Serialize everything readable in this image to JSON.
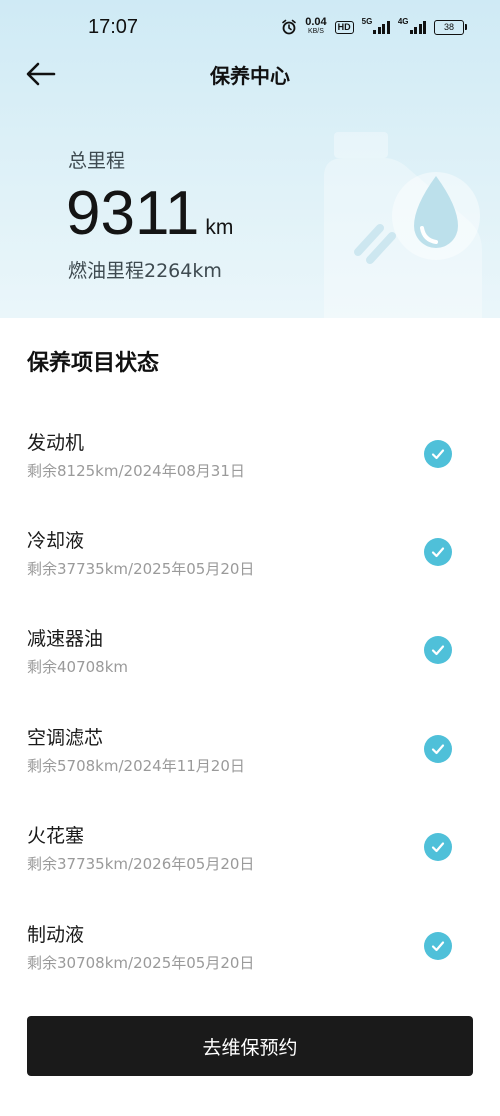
{
  "status_bar": {
    "time": "17:07",
    "net_speed_value": "0.04",
    "net_speed_unit": "KB/S",
    "hd_label": "HD",
    "sim1_label": "5G",
    "sim2_label": "4G",
    "battery": "38"
  },
  "header": {
    "title": "保养中心"
  },
  "mileage": {
    "total_label": "总里程",
    "total_value": "9311",
    "total_unit": "km",
    "fuel_mileage": "燃油里程2264km"
  },
  "section_title": "保养项目状态",
  "items": [
    {
      "name": "发动机",
      "detail": "剩余8125km/2024年08月31日",
      "status_icon": "check-icon"
    },
    {
      "name": "冷却液",
      "detail": "剩余37735km/2025年05月20日",
      "status_icon": "check-icon"
    },
    {
      "name": "减速器油",
      "detail": "剩余40708km",
      "status_icon": "check-icon"
    },
    {
      "name": "空调滤芯",
      "detail": "剩余5708km/2024年11月20日",
      "status_icon": "check-icon"
    },
    {
      "name": "火花塞",
      "detail": "剩余37735km/2026年05月20日",
      "status_icon": "check-icon"
    },
    {
      "name": "制动液",
      "detail": "剩余30708km/2025年05月20日",
      "status_icon": "check-icon"
    }
  ],
  "action_button": "去维保预约",
  "colors": {
    "accent": "#4fc0d9",
    "button_bg": "#1a1a1a",
    "hero_bg": "#d6eef6"
  }
}
